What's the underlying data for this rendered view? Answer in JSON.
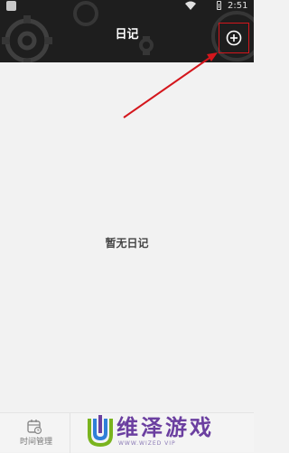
{
  "status_bar": {
    "time": "2:51"
  },
  "header": {
    "title": "日记"
  },
  "toolbar": {
    "add_icon": "plus-circle-icon"
  },
  "main": {
    "empty_text": "暂无日记"
  },
  "bottom_nav": {
    "items": [
      {
        "label": "时间管理",
        "icon": "calendar-clock-icon"
      }
    ]
  },
  "watermark": {
    "title": "维泽游戏",
    "subtitle": "WWW.WIZED VIP"
  },
  "colors": {
    "header_bg": "#1e1e1e",
    "highlight": "#d4161c",
    "background": "#f2f2f2"
  }
}
